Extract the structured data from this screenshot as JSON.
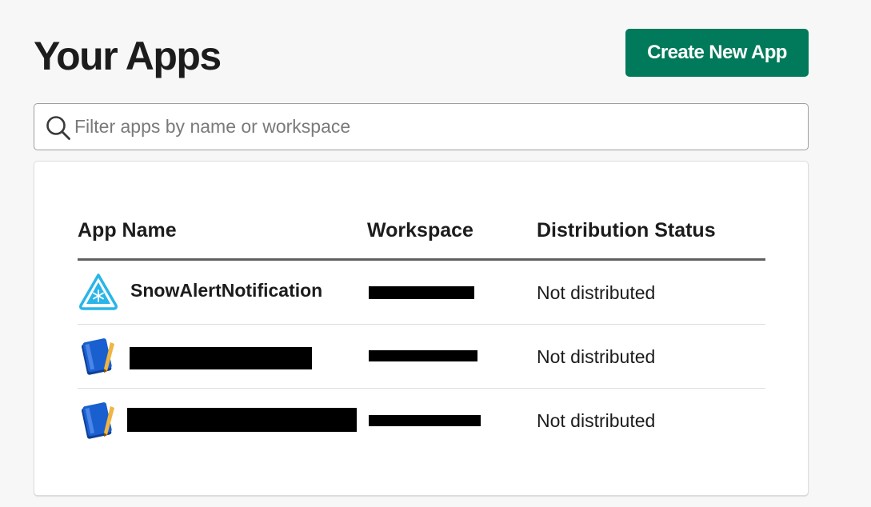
{
  "page": {
    "title": "Your Apps",
    "create_button": "Create New App"
  },
  "search": {
    "icon": "search-icon",
    "placeholder": "Filter apps by name or workspace",
    "value": ""
  },
  "table": {
    "headers": {
      "app_name": "App Name",
      "workspace": "Workspace",
      "status": "Distribution Status"
    },
    "rows": [
      {
        "icon": "snowflake-app-icon",
        "name": "SnowAlertNotification",
        "name_redacted": false,
        "workspace_redacted": true,
        "status": "Not distributed"
      },
      {
        "icon": "default-app-book-icon",
        "name": "",
        "name_redacted": true,
        "workspace_redacted": true,
        "status": "Not distributed"
      },
      {
        "icon": "default-app-book-icon",
        "name": "",
        "name_redacted": true,
        "workspace_redacted": true,
        "status": "Not distributed"
      }
    ]
  },
  "colors": {
    "primary_button": "#007a5a",
    "page_background": "#f7f7f7",
    "text": "#1d1c1d",
    "snowflake_icon": "#29b5e8",
    "book_icon": "#1a5fd0"
  }
}
